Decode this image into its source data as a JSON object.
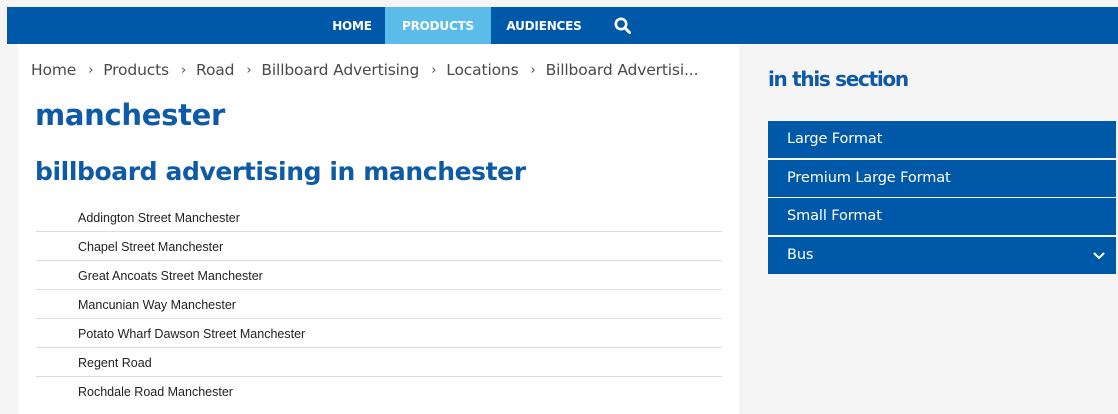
{
  "nav": {
    "home": "HOME",
    "products": "PRODUCTS",
    "audiences": "AUDIENCES",
    "search_icon": "search-icon",
    "colors": {
      "bar": "#0059a8",
      "active": "#5bbcea"
    }
  },
  "breadcrumb": {
    "items": [
      "Home",
      "Products",
      "Road",
      "Billboard Advertising",
      "Locations",
      "Billboard Advertisi..."
    ]
  },
  "main": {
    "title": "manchester",
    "subtitle": "billboard advertising in manchester",
    "locations": [
      "Addington Street Manchester",
      "Chapel Street Manchester",
      "Great Ancoats Street Manchester",
      "Mancunian Way Manchester",
      "Potato Wharf Dawson Street Manchester",
      "Regent Road",
      "Rochdale Road Manchester"
    ]
  },
  "sidebar": {
    "title": "in this section",
    "items": [
      "Large Format",
      "Premium Large Format",
      "Small Format",
      "Bus"
    ],
    "expand_icon": "chevron-down-icon"
  },
  "colors": {
    "accent": "#0e5aa7",
    "text": "#222222",
    "background": "#f5f5f5"
  }
}
